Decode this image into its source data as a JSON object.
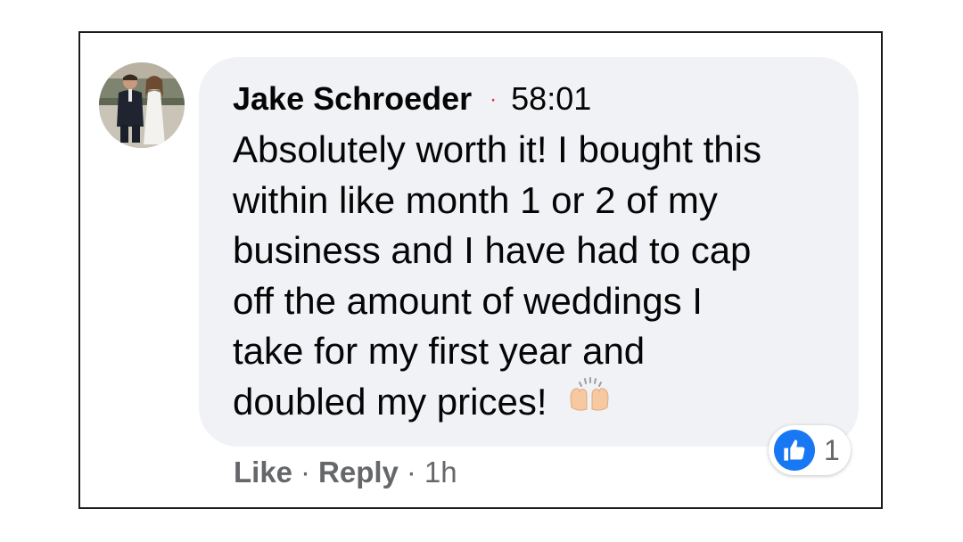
{
  "comment": {
    "author": "Jake Schroeder",
    "timestamp": "58:01",
    "text_lines": [
      "Absolutely worth it! I bought this",
      "within like month 1 or 2 of my",
      "business and I have had to cap",
      "off the amount of weddings I",
      "take for my first year and",
      "doubled my prices!"
    ],
    "emoji": "raising-hands-emoji"
  },
  "actions": {
    "like_label": "Like",
    "separator": "·",
    "reply_label": "Reply",
    "age": "1h"
  },
  "reactions": {
    "icon": "thumbs-up-icon",
    "count": "1",
    "color": "#1877f2"
  },
  "colors": {
    "bubble": "#f0f2f5",
    "text": "#050505",
    "muted": "#65676b",
    "dot": "#e4293b"
  }
}
